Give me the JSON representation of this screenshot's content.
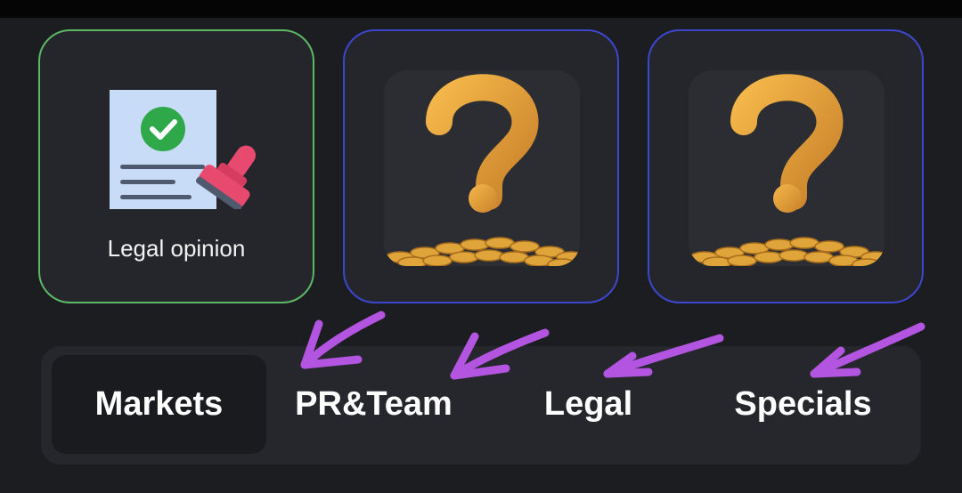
{
  "cards": [
    {
      "label": "Legal opinion",
      "icon": "legal-document-stamp-icon",
      "state": "unlocked",
      "border_color": "#5cb865"
    },
    {
      "icon": "question-coins-icon",
      "state": "locked",
      "border_color": "#3d46cf"
    },
    {
      "icon": "question-coins-icon",
      "state": "locked",
      "border_color": "#3d46cf"
    }
  ],
  "tabs": [
    {
      "label": "Markets",
      "active": true
    },
    {
      "label": "PR&Team",
      "active": false
    },
    {
      "label": "Legal",
      "active": false
    },
    {
      "label": "Specials",
      "active": false
    }
  ],
  "annotation_color": "#b355e0"
}
